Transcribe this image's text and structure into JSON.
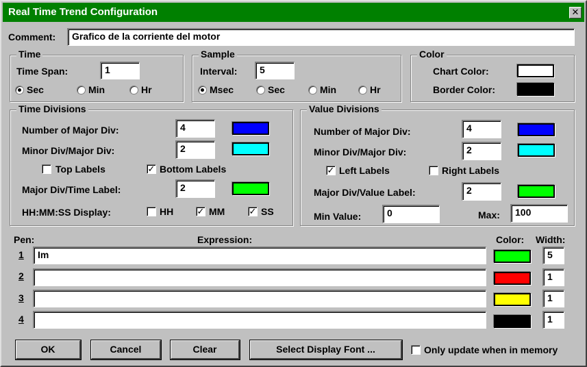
{
  "window": {
    "title": "Real Time Trend Configuration",
    "close_glyph": "✕"
  },
  "comment": {
    "label": "Comment:",
    "value": "Grafico de la corriente del motor"
  },
  "time_group": {
    "title": "Time",
    "span_label": "Time Span:",
    "span_value": "1",
    "units": [
      {
        "label": "Sec",
        "selected": true
      },
      {
        "label": "Min",
        "selected": false
      },
      {
        "label": "Hr",
        "selected": false
      }
    ]
  },
  "sample_group": {
    "title": "Sample",
    "interval_label": "Interval:",
    "interval_value": "5",
    "units": [
      {
        "label": "Msec",
        "selected": true
      },
      {
        "label": "Sec",
        "selected": false
      },
      {
        "label": "Min",
        "selected": false
      },
      {
        "label": "Hr",
        "selected": false
      }
    ]
  },
  "color_group": {
    "title": "Color",
    "chart_label": "Chart Color:",
    "chart_color": "#ffffff",
    "border_label": "Border Color:",
    "border_color": "#000000"
  },
  "time_divisions": {
    "title": "Time Divisions",
    "major_label": "Number of Major Div:",
    "major_value": "4",
    "major_color": "#0000ff",
    "minor_label": "Minor Div/Major Div:",
    "minor_value": "2",
    "minor_color": "#00ffff",
    "top_labels": "Top Labels",
    "top_checked": false,
    "bottom_labels": "Bottom Labels",
    "bottom_checked": true,
    "label_div_label": "Major Div/Time Label:",
    "label_div_value": "2",
    "label_color": "#00ff00",
    "hms_label": "HH:MM:SS Display:",
    "hh": "HH",
    "hh_checked": false,
    "mm": "MM",
    "mm_checked": true,
    "ss": "SS",
    "ss_checked": true
  },
  "value_divisions": {
    "title": "Value Divisions",
    "major_label": "Number of Major Div:",
    "major_value": "4",
    "major_color": "#0000ff",
    "minor_label": "Minor Div/Major Div:",
    "minor_value": "2",
    "minor_color": "#00ffff",
    "left_labels": "Left Labels",
    "left_checked": true,
    "right_labels": "Right Labels",
    "right_checked": false,
    "label_div_label": "Major Div/Value Label:",
    "label_div_value": "2",
    "label_color": "#00ff00",
    "min_label": "Min Value:",
    "min_value": "0",
    "max_label": "Max:",
    "max_value": "100"
  },
  "pens": {
    "pen_header": "Pen:",
    "expression_header": "Expression:",
    "color_header": "Color:",
    "width_header": "Width:",
    "rows": [
      {
        "num": "1",
        "expression": "Im",
        "color": "#00ff00",
        "width": "5"
      },
      {
        "num": "2",
        "expression": "",
        "color": "#ff0000",
        "width": "1"
      },
      {
        "num": "3",
        "expression": "",
        "color": "#ffff00",
        "width": "1"
      },
      {
        "num": "4",
        "expression": "",
        "color": "#000000",
        "width": "1"
      }
    ]
  },
  "buttons": {
    "ok": "OK",
    "cancel": "Cancel",
    "clear": "Clear",
    "font": "Select Display Font ...",
    "only_update": "Only update when in memory",
    "only_update_checked": false
  }
}
